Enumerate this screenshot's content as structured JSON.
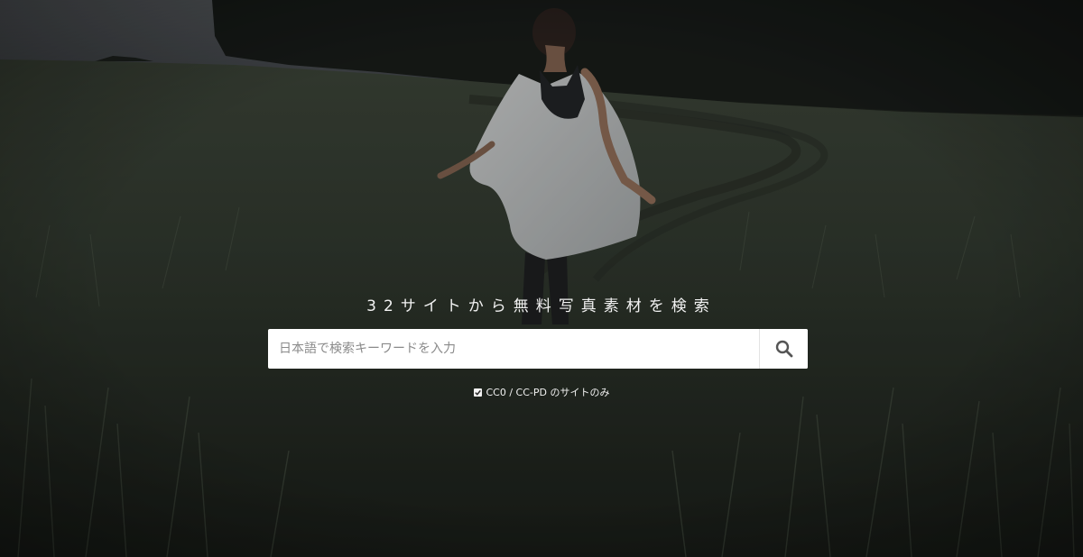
{
  "hero": {
    "headline": "32サイトから無料写真素材を検索"
  },
  "search": {
    "placeholder": "日本語で検索キーワードを入力",
    "button_icon": "search-icon"
  },
  "filter": {
    "checked": true,
    "label": "CC0 / CC-PD のサイトのみ"
  },
  "colors": {
    "search_box_bg": "#ffffff",
    "headline_text": "#f2f2f2",
    "icon": "#555555"
  }
}
